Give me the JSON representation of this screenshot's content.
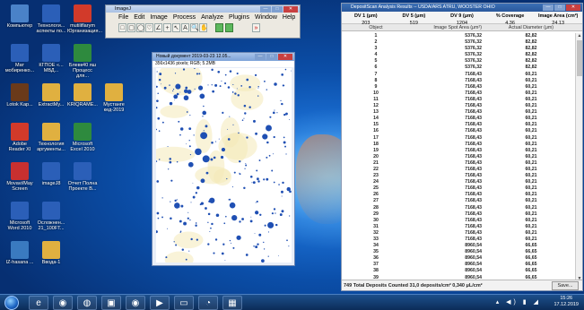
{
  "colors": {
    "desktop": "#0b4ea8",
    "imagej_green": "#5cb85c",
    "row_highlight": "#dfe9f8"
  },
  "desktop_icons": [
    {
      "label": "Компьютер",
      "icon": "computer-icon",
      "color": "#4a82c8"
    },
    {
      "label": "Технологи... аспекты по...",
      "icon": "word-doc-icon",
      "color": "#2b5fb8"
    },
    {
      "label": "mutiliflarym Юрганизация...",
      "icon": "pdf-icon",
      "color": "#d23a2a"
    },
    {
      "label": "Blog",
      "icon": "word-doc-icon",
      "color": "#2b5fb8"
    },
    {
      "label": "Мат мобиренко...",
      "icon": "word-doc-icon",
      "color": "#2b5fb8"
    },
    {
      "label": "КГПОЕ «... МВД...",
      "icon": "word-doc-icon",
      "color": "#2b5fb8"
    },
    {
      "label": "Блевк40 яш Процесс для...",
      "icon": "excel-icon",
      "color": "#2e8a3e"
    },
    {
      "label": "Lotok Kap...",
      "icon": "app-icon",
      "color": "#6a3a1a"
    },
    {
      "label": "ExtractMy...",
      "icon": "folder-icon",
      "color": "#e0b040"
    },
    {
      "label": "KRIQRAME...",
      "icon": "folder-icon",
      "color": "#e0b040"
    },
    {
      "label": "Мустанге кед-2019",
      "icon": "folder-icon",
      "color": "#e0b040"
    },
    {
      "label": "Adobe Reader XI",
      "icon": "pdf-icon",
      "color": "#d23a2a"
    },
    {
      "label": "Технология аргументы...",
      "icon": "folder-icon",
      "color": "#e0b040"
    },
    {
      "label": "Microsoft Excel 2010",
      "icon": "excel-icon",
      "color": "#2e8a3e"
    },
    {
      "label": "Movavi/May Screen",
      "icon": "app-icon",
      "color": "#c83030"
    },
    {
      "label": "imageJ8",
      "icon": "word-doc-icon",
      "color": "#2b5fb8"
    },
    {
      "label": "Отчет Полна Проекте В...",
      "icon": "word-doc-icon",
      "color": "#2b5fb8"
    },
    {
      "label": "Microsoft Word 2010",
      "icon": "word-icon",
      "color": "#2b5fb8"
    },
    {
      "label": "Осложнен... 21_100FT...",
      "icon": "word-doc-icon",
      "color": "#2b5fb8"
    },
    {
      "label": "IZ-hasana ...",
      "icon": "app-icon",
      "color": "#3a7ac0"
    },
    {
      "label": "Ввода-1",
      "icon": "folder-icon",
      "color": "#e0b040"
    }
  ],
  "imagej": {
    "title": "ImageJ",
    "menu": [
      "File",
      "Edit",
      "Image",
      "Process",
      "Analyze",
      "Plugins",
      "Window",
      "Help"
    ],
    "tools": [
      "□",
      "▢",
      "◯",
      "♡",
      "∠",
      "+",
      "↖",
      "A",
      "🔍",
      "✋"
    ]
  },
  "image_window": {
    "title": "Новый документ 2019-03-23 12.05...",
    "info": "356x1436 pixels; RGB; 5.2MB"
  },
  "deposit": {
    "title": "DepositScan Analysis Results -- USDA/ARS ATRU, WOOSTER OHIO",
    "summary_headers": [
      "DV 1 (μm)",
      "DV 5 (μm)",
      "DV 9 (μm)",
      "% Coverage",
      "Image Area (cm²)"
    ],
    "summary_values": [
      "203",
      "519",
      "1204",
      "4.36",
      "24.13"
    ],
    "column_headers": [
      "Object",
      "Image Spot Area (μm²)",
      "Actual Diameter (μm)"
    ],
    "rows": [
      [
        "1",
        "5376,32",
        "82,82"
      ],
      [
        "2",
        "5376,32",
        "82,82"
      ],
      [
        "3",
        "5376,32",
        "82,82"
      ],
      [
        "4",
        "5376,32",
        "82,82"
      ],
      [
        "5",
        "5376,32",
        "82,82"
      ],
      [
        "6",
        "5376,32",
        "82,82"
      ],
      [
        "7",
        "7168,43",
        "60,21"
      ],
      [
        "8",
        "7168,43",
        "60,21"
      ],
      [
        "9",
        "7168,43",
        "60,21"
      ],
      [
        "10",
        "7168,43",
        "60,21"
      ],
      [
        "11",
        "7168,43",
        "60,21"
      ],
      [
        "12",
        "7168,43",
        "60,21"
      ],
      [
        "13",
        "7168,43",
        "60,21"
      ],
      [
        "14",
        "7168,43",
        "60,21"
      ],
      [
        "15",
        "7168,43",
        "60,21"
      ],
      [
        "16",
        "7168,43",
        "60,21"
      ],
      [
        "17",
        "7168,43",
        "60,21"
      ],
      [
        "18",
        "7168,43",
        "60,21"
      ],
      [
        "19",
        "7168,43",
        "60,21"
      ],
      [
        "20",
        "7168,43",
        "60,21"
      ],
      [
        "21",
        "7168,43",
        "60,21"
      ],
      [
        "22",
        "7168,43",
        "60,21"
      ],
      [
        "23",
        "7168,43",
        "60,21"
      ],
      [
        "24",
        "7168,43",
        "60,21"
      ],
      [
        "25",
        "7168,43",
        "60,21"
      ],
      [
        "26",
        "7168,43",
        "60,21"
      ],
      [
        "27",
        "7168,43",
        "60,21"
      ],
      [
        "28",
        "7168,43",
        "60,21"
      ],
      [
        "29",
        "7168,43",
        "60,21"
      ],
      [
        "30",
        "7168,43",
        "60,21"
      ],
      [
        "31",
        "7168,43",
        "60,21"
      ],
      [
        "32",
        "7168,43",
        "60,21"
      ],
      [
        "33",
        "7168,43",
        "60,21"
      ],
      [
        "34",
        "8960,54",
        "66,65"
      ],
      [
        "35",
        "8960,54",
        "66,65"
      ],
      [
        "36",
        "8960,54",
        "66,65"
      ],
      [
        "37",
        "8960,54",
        "66,65"
      ],
      [
        "38",
        "8960,54",
        "66,65"
      ],
      [
        "39",
        "8960,54",
        "66,65"
      ]
    ],
    "footer": "749 Total Deposits Counted     31,0 deposits/cm²     0,340 μL/cm²",
    "save_label": "Save..."
  },
  "taskbar": {
    "apps": [
      "ie-icon",
      "chrome-icon",
      "firefox-icon",
      "save-icon",
      "chrome-icon",
      "media-player-icon",
      "explorer-icon",
      "imagej-icon",
      "deposit-icon"
    ],
    "time": "15:26",
    "date": "17.12.2019"
  }
}
